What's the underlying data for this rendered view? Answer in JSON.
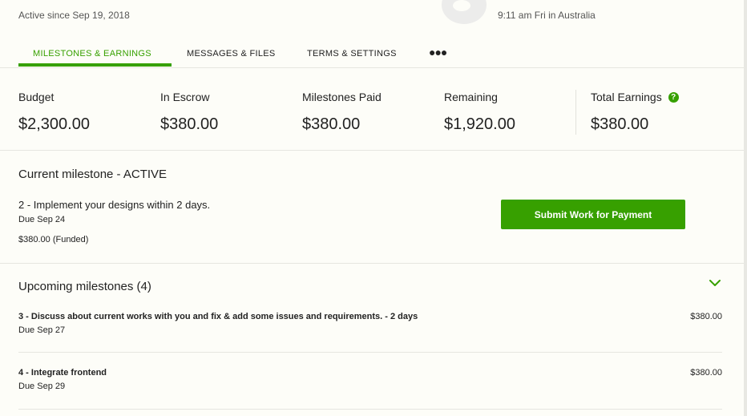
{
  "header": {
    "active_since": "Active since Sep 19, 2018",
    "local_time": "9:11 am Fri in Australia"
  },
  "tabs": [
    {
      "label": "MILESTONES & EARNINGS",
      "active": true
    },
    {
      "label": "MESSAGES & FILES",
      "active": false
    },
    {
      "label": "TERMS & SETTINGS",
      "active": false
    }
  ],
  "more_label": "●●●",
  "stats": [
    {
      "label": "Budget",
      "value": "$2,300.00"
    },
    {
      "label": "In Escrow",
      "value": "$380.00"
    },
    {
      "label": "Milestones Paid",
      "value": "$380.00"
    },
    {
      "label": "Remaining",
      "value": "$1,920.00"
    },
    {
      "label": "Total Earnings",
      "value": "$380.00"
    }
  ],
  "help_glyph": "?",
  "current_milestone": {
    "title": "Current milestone - ACTIVE",
    "name": "2 - Implement your designs within 2 days.",
    "due": "Due Sep 24",
    "amount": "$380.00 (Funded)",
    "submit_label": "Submit Work for Payment"
  },
  "upcoming": {
    "title": "Upcoming milestones (4)",
    "items": [
      {
        "name": "3 - Discuss about current works with you and fix & add some issues and requirements. - 2 days",
        "due": "Due Sep 27",
        "amount": "$380.00"
      },
      {
        "name": "4 - Integrate frontend",
        "due": "Due Sep 29",
        "amount": "$380.00"
      }
    ]
  },
  "colors": {
    "accent": "#37a000",
    "background": "#fdfdf8"
  },
  "icons": [
    "help-icon",
    "chevron-down-icon",
    "more-icon"
  ]
}
